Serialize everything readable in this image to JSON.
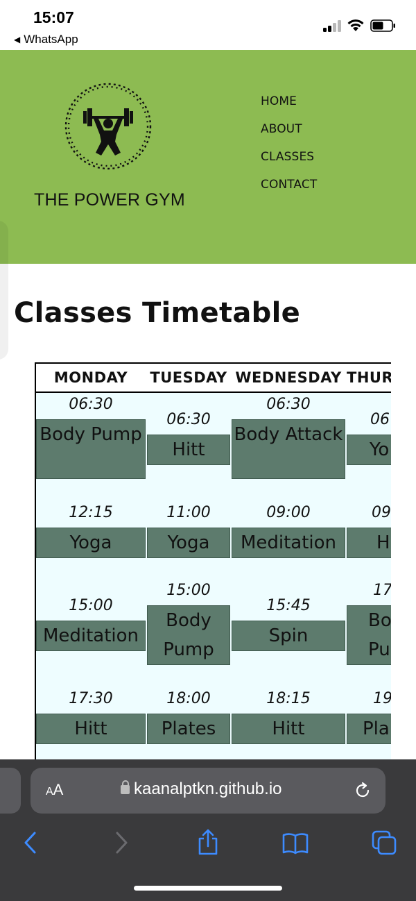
{
  "status_bar": {
    "time": "15:07",
    "back_app": "WhatsApp"
  },
  "header": {
    "logo_text": "THE POWER GYM",
    "nav": [
      "HOME",
      "ABOUT",
      "CLASSES",
      "CONTACT"
    ],
    "background_color": "#8dbb52"
  },
  "page_title": "Classes Timetable",
  "timetable": {
    "days": [
      "MONDAY",
      "TUESDAY",
      "WEDNESDAY",
      "THUR"
    ],
    "monday": [
      {
        "time": "06:30",
        "class": "Body Pump"
      },
      {
        "time": "12:15",
        "class": "Yoga"
      },
      {
        "time": "15:00",
        "class": "Meditation"
      },
      {
        "time": "17:30",
        "class": "Hitt"
      }
    ],
    "tuesday": [
      {
        "time": "06:30",
        "class": "Hitt"
      },
      {
        "time": "11:00",
        "class": "Yoga"
      },
      {
        "time": "15:00",
        "class": "Body Pump"
      },
      {
        "time": "18:00",
        "class": "Plates"
      }
    ],
    "wednesday": [
      {
        "time": "06:30",
        "class": "Body Attack"
      },
      {
        "time": "09:00",
        "class": "Meditation"
      },
      {
        "time": "15:45",
        "class": "Spin"
      },
      {
        "time": "18:15",
        "class": "Hitt"
      }
    ],
    "thursday_partial": [
      {
        "time": "06",
        "class": "Yo"
      },
      {
        "time": "09",
        "class": "H"
      },
      {
        "time": "17",
        "class": "Bo Pu"
      },
      {
        "time": "19",
        "class": "Pla"
      }
    ],
    "cell_color": "#5d7b6d",
    "table_bg": "#eefdff"
  },
  "browser": {
    "aa_small": "A",
    "aa_big": "A",
    "url": "kaanalptkn.github.io",
    "icons": [
      "back-icon",
      "forward-icon",
      "share-icon",
      "bookmarks-icon",
      "tabs-icon",
      "reload-icon",
      "lock-icon"
    ]
  }
}
